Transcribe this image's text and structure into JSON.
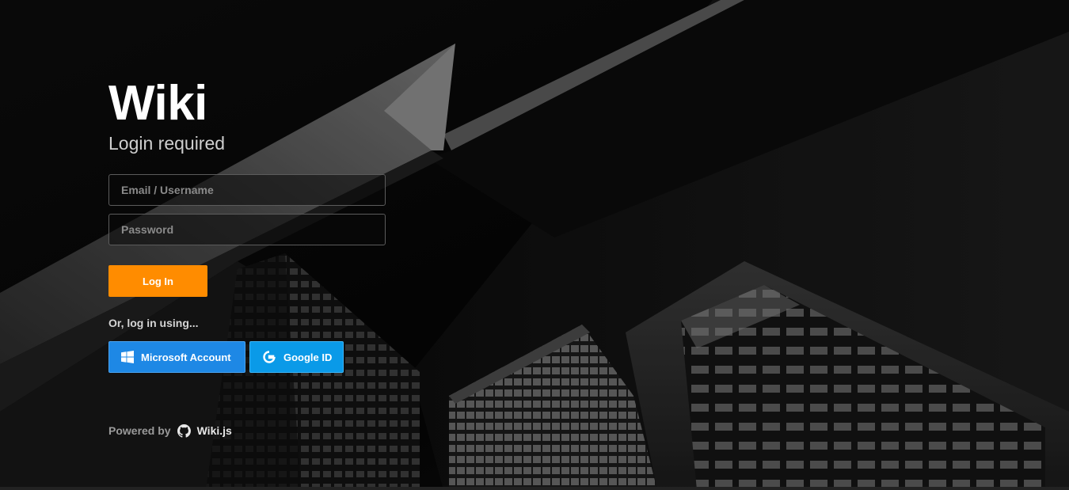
{
  "app": {
    "title": "Wiki",
    "subtitle": "Login required"
  },
  "form": {
    "username_placeholder": "Email / Username",
    "username_value": "",
    "password_placeholder": "Password",
    "password_value": "",
    "login_label": "Log In"
  },
  "providers": {
    "intro": "Or, log in using...",
    "microsoft_label": "Microsoft Account",
    "google_label": "Google ID"
  },
  "footer": {
    "powered_by": "Powered by",
    "link_label": "Wiki.js"
  },
  "colors": {
    "login_button": "#ff8c00",
    "microsoft_button": "#1e88e5",
    "google_button": "#0a9ae8",
    "background": "#070707"
  },
  "icons": {
    "microsoft": "windows-logo-icon",
    "google": "google-g-icon",
    "footer": "github-icon"
  }
}
